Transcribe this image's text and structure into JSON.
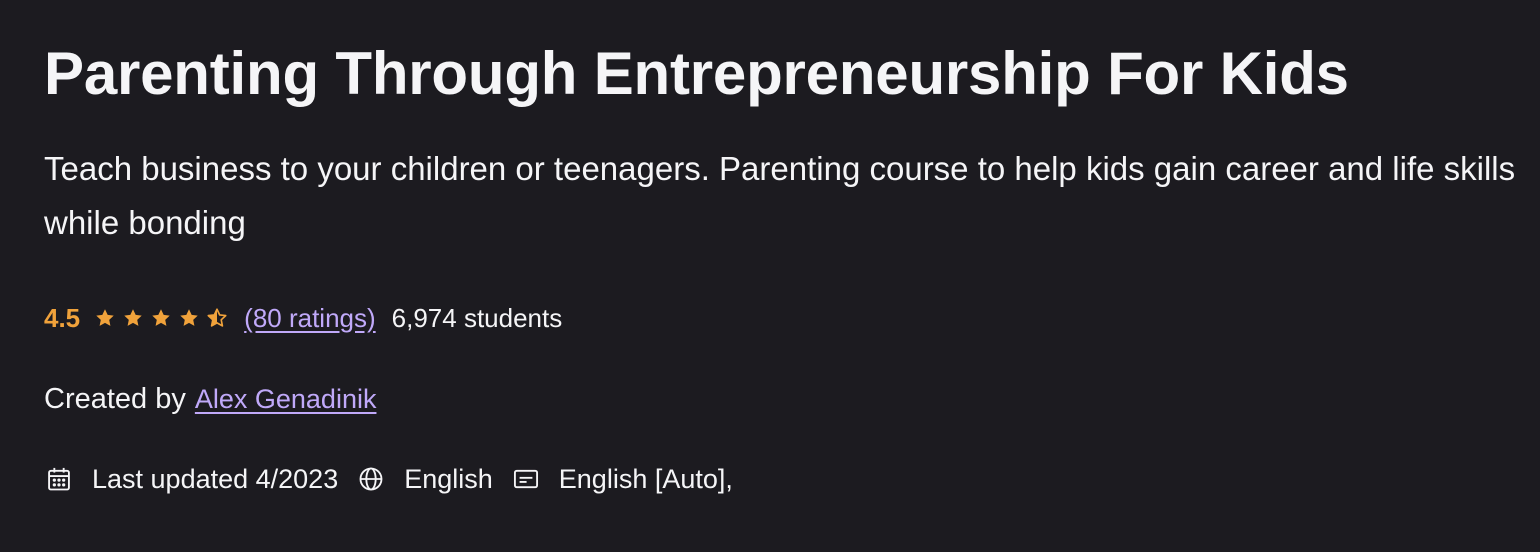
{
  "course": {
    "title": "Parenting Through Entrepreneurship For Kids",
    "subtitle": "Teach business to your children or teenagers. Parenting course to help kids gain career and life skills while bonding"
  },
  "rating": {
    "score": "4.5",
    "stars": 4.5,
    "stars_max": 5,
    "ratings_link": "(80 ratings)",
    "students": "6,974 students"
  },
  "creator": {
    "label": "Created by",
    "author": "Alex Genadinik"
  },
  "meta": {
    "last_updated": "Last updated 4/2023",
    "language": "English",
    "captions": "English [Auto],"
  },
  "icons": {
    "calendar": "calendar-icon",
    "language": "globe-icon",
    "captions": "closed-captions-icon",
    "star": "star-icon"
  },
  "colors": {
    "background": "#1c1b20",
    "text": "#f5f5f7",
    "rating": "#f0a23b",
    "link": "#c0a9f9"
  }
}
